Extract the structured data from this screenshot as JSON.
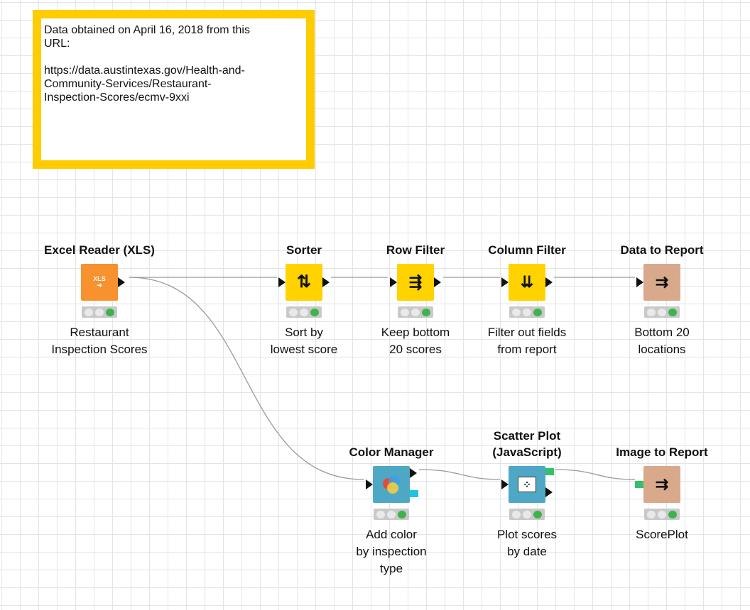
{
  "annotation": {
    "text": "Data obtained on April 16, 2018 from this\nURL:\n\nhttps://data.austintexas.gov/Health-and-\nCommunity-Services/Restaurant-\nInspection-Scores/ecmv-9xxi"
  },
  "colors": {
    "annotation_border": "#ffcc00",
    "source_node": "#f7922e",
    "manipulator_node": "#ffd200",
    "view_node": "#4fa7c6",
    "report_node": "#d8a98a",
    "port_data": "#111111",
    "port_image": "#36c06b",
    "port_color_model": "#1ec3e3",
    "status_ok": "#3cb44b"
  },
  "nodes": [
    {
      "id": "excel",
      "title": "Excel Reader (XLS)",
      "label": "Restaurant\nInspection Scores",
      "icon": "xls-icon",
      "icon_text": "XLS"
    },
    {
      "id": "sorter",
      "title": "Sorter",
      "label": "Sort by\nlowest score",
      "icon": "sort-icon",
      "icon_text": "⇅"
    },
    {
      "id": "rowfilter",
      "title": "Row Filter",
      "label": "Keep bottom\n20 scores",
      "icon": "row-filter-icon",
      "icon_text": "⇶"
    },
    {
      "id": "colfilter",
      "title": "Column Filter",
      "label": "Filter out fields\nfrom report",
      "icon": "column-filter-icon",
      "icon_text": "⇊"
    },
    {
      "id": "datareport",
      "title": "Data to Report",
      "label": "Bottom 20\nlocations",
      "icon": "report-icon",
      "icon_text": "⇉"
    },
    {
      "id": "colormgr",
      "title": "Color Manager",
      "label": "Add color\nby inspection\ntype",
      "icon": "color-circles-icon",
      "icon_text": ""
    },
    {
      "id": "scatter",
      "title": "Scatter Plot\n(JavaScript)",
      "label": "Plot scores\nby date",
      "icon": "scatter-plot-icon",
      "icon_text": "⁘"
    },
    {
      "id": "imagereport",
      "title": "Image to Report",
      "label": "ScorePlot",
      "icon": "image-report-icon",
      "icon_text": "⇉"
    }
  ]
}
